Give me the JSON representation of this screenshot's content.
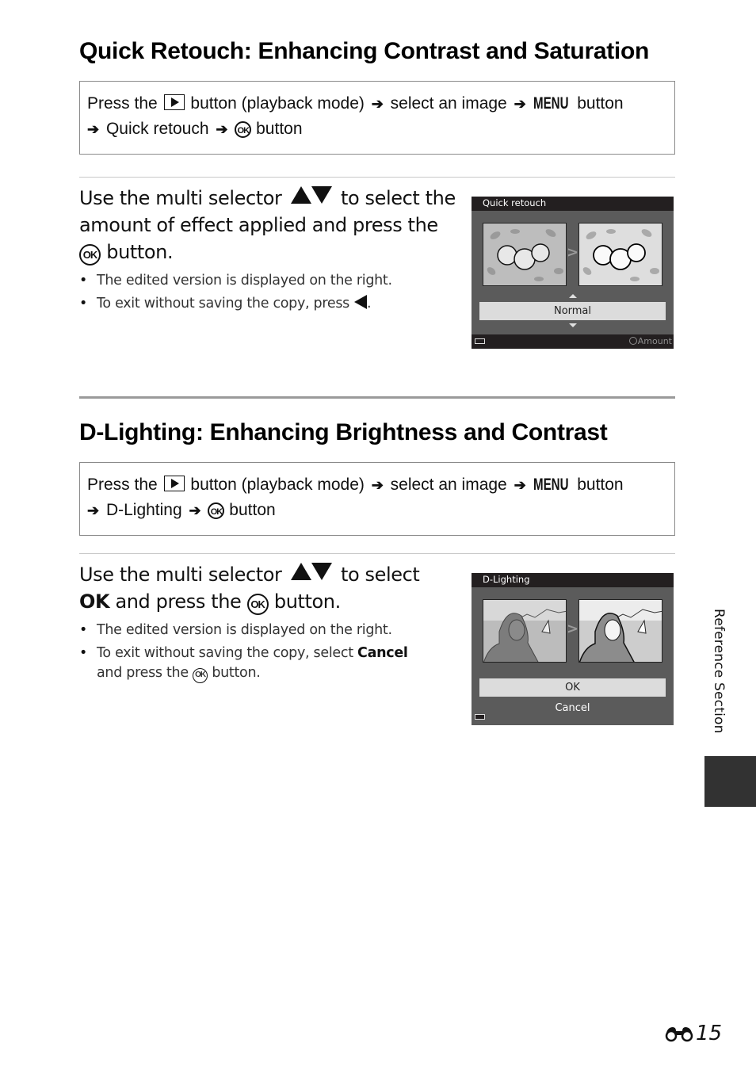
{
  "sections": [
    {
      "title": "Quick Retouch: Enhancing Contrast and Saturation",
      "path": {
        "press_the": "Press the",
        "button_playback": "button (playback mode)",
        "select_image": "select an image",
        "menu_label": "MENU",
        "button": "button",
        "menu_item": "Quick retouch",
        "ok_label": "OK",
        "button_end": "button"
      },
      "step": {
        "part1": "Use the multi selector",
        "part2": "to select the amount of effect applied and press the",
        "part3": "button."
      },
      "bullets": [
        "The edited version is displayed on the right.",
        "To exit without saving the copy, press"
      ],
      "screen": {
        "title": "Quick retouch",
        "option": "Normal",
        "hint": "Amount"
      }
    },
    {
      "title": "D-Lighting: Enhancing Brightness and Contrast",
      "path": {
        "press_the": "Press the",
        "button_playback": "button (playback mode)",
        "select_image": "select an image",
        "menu_label": "MENU",
        "button": "button",
        "menu_item": "D-Lighting",
        "ok_label": "OK",
        "button_end": "button"
      },
      "step": {
        "part1": "Use the multi selector",
        "part2": "to select",
        "bold": "OK",
        "part3": "and press the",
        "part4": "button."
      },
      "bullets": [
        "The edited version is displayed on the right.",
        {
          "text": "To exit without saving the copy, select",
          "bold": "Cancel",
          "after": "and press the",
          "end": "button."
        }
      ],
      "screen": {
        "title": "D-Lighting",
        "options": [
          "OK",
          "Cancel"
        ],
        "selected": "OK"
      }
    }
  ],
  "side_tab": "Reference Section",
  "page_number": "15",
  "ok_glyph": "OK",
  "bullet_glyph": "•",
  "arrow_glyph": "➔",
  "chevron_glyph": ">"
}
